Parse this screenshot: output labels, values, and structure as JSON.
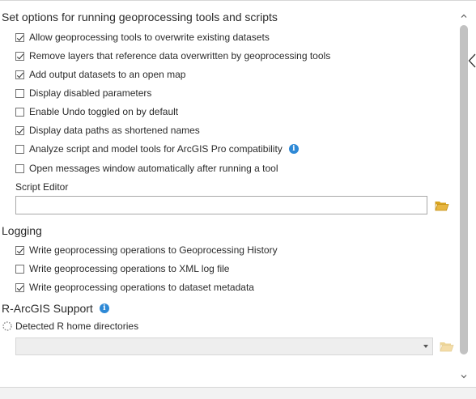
{
  "run_options": {
    "title": "Set options for running geoprocessing tools and scripts",
    "items": [
      {
        "label": "Allow geoprocessing tools to overwrite existing datasets",
        "checked": true
      },
      {
        "label": "Remove layers that reference data overwritten by geoprocessing tools",
        "checked": true
      },
      {
        "label": "Add output datasets to an open map",
        "checked": true
      },
      {
        "label": "Display disabled parameters",
        "checked": false
      },
      {
        "label": "Enable Undo toggled on by default",
        "checked": false
      },
      {
        "label": "Display data paths as shortened names",
        "checked": true
      },
      {
        "label": "Analyze script and model tools for ArcGIS Pro compatibility",
        "checked": false,
        "info": true
      },
      {
        "label": "Open messages window automatically after running a tool",
        "checked": false
      }
    ],
    "script_editor_label": "Script Editor",
    "script_editor_value": ""
  },
  "logging": {
    "title": "Logging",
    "items": [
      {
        "label": "Write geoprocessing operations to Geoprocessing History",
        "checked": true
      },
      {
        "label": "Write geoprocessing operations to XML log file",
        "checked": false
      },
      {
        "label": "Write geoprocessing operations to dataset metadata",
        "checked": true
      }
    ]
  },
  "r_support": {
    "title": "R-ArcGIS Support",
    "detected_label": "Detected R home directories",
    "selected_value": ""
  },
  "icons": {
    "info": "info-icon",
    "folder": "folder-open-icon",
    "spinner": "loading-spinner-icon",
    "scroll_up": "scroll-up-arrow-icon",
    "scroll_down": "scroll-down-arrow-icon",
    "panel_edge": "chevron-left-icon"
  },
  "colors": {
    "info_blue": "#2e89d6",
    "folder_yellow": "#e8b640",
    "scroll_thumb": "#c2c2c2"
  }
}
